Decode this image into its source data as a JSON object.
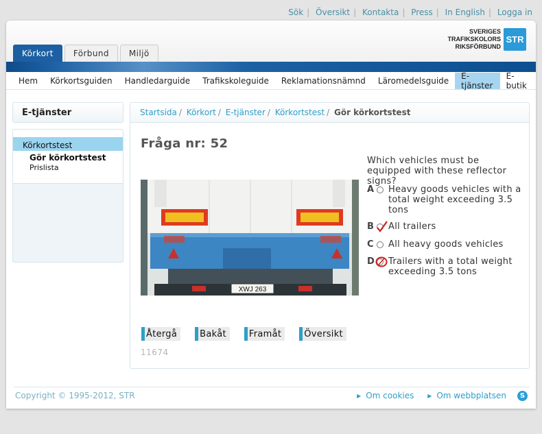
{
  "toplinks": [
    "Sök",
    "Översikt",
    "Kontakta",
    "Press",
    "In English",
    "Logga in"
  ],
  "logo": {
    "line1": "SVERIGES",
    "line2": "TRAFIKSKOLORS",
    "line3": "RIKSFÖRBUND",
    "mark": "STR"
  },
  "tabs": [
    "Körkort",
    "Förbund",
    "Miljö"
  ],
  "nav": [
    "Hem",
    "Körkortsguiden",
    "Handledarguide",
    "Trafikskoleguide",
    "Reklamationsnämnd",
    "Läromedelsguide",
    "E-tjänster",
    "E-butik"
  ],
  "sidebar": {
    "title": "E-tjänster",
    "item": "Körkortstest",
    "sub1": "Gör körkortstest",
    "sub2": "Prislista"
  },
  "breadcrumb": [
    "Startsida",
    "Körkort",
    "E-tjänster",
    "Körkortstest",
    "Gör körkortstest"
  ],
  "question": {
    "title": "Fråga nr: 52",
    "text": "Which vehicles must be equipped with these reflector signs?",
    "answers": [
      {
        "letter": "A",
        "text": "Heavy goods vehicles with a total weight exceeding 3.5 tons"
      },
      {
        "letter": "B",
        "text": "All trailers"
      },
      {
        "letter": "C",
        "text": "All heavy goods vehicles"
      },
      {
        "letter": "D",
        "text": "Trailers with a total weight exceeding 3.5 tons"
      }
    ],
    "plate": "XWJ 263"
  },
  "buttons": [
    "Återgå",
    "Bakåt",
    "Framåt",
    "Översikt"
  ],
  "code": "11674",
  "footer": {
    "copyright": "Copyright © 1995-2012, STR",
    "link1": "Om cookies",
    "link2": "Om webbplatsen"
  },
  "colors": {
    "accent": "#1c5fa2",
    "link": "#2f9fc8",
    "active_nav": "#a7d5ef",
    "sidebar_active": "#9bd4ee",
    "mark": "#d02020"
  },
  "icons": {
    "checkmark": "check-mark",
    "circle": "circle-mark",
    "skype": "skype-icon"
  }
}
